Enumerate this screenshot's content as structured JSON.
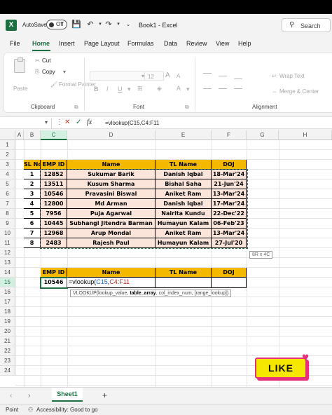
{
  "titlebar": {
    "autosave_label": "AutoSave",
    "autosave_state": "Off",
    "doc_title": "Book1 - Excel",
    "search_placeholder": "Search"
  },
  "menu": {
    "tabs": [
      "File",
      "Home",
      "Insert",
      "Page Layout",
      "Formulas",
      "Data",
      "Review",
      "View",
      "Help"
    ],
    "active": "Home"
  },
  "ribbon": {
    "paste": "Paste",
    "cut": "Cut",
    "copy": "Copy",
    "format_painter": "Format Painter",
    "clipboard": "Clipboard",
    "font_size": "12",
    "font_group": "Font",
    "wrap_text": "Wrap Text",
    "merge_center": "Merge & Center",
    "alignment_group": "Alignment"
  },
  "formula_bar": {
    "formula": "=vlookup(C15,C4:F11"
  },
  "columns": [
    "A",
    "B",
    "C",
    "D",
    "E",
    "F",
    "G",
    "H"
  ],
  "rows": [
    "1",
    "2",
    "3",
    "4",
    "5",
    "6",
    "7",
    "8",
    "9",
    "10",
    "11",
    "12",
    "13",
    "14",
    "15",
    "16",
    "17",
    "18",
    "19",
    "20",
    "21",
    "22",
    "23",
    "24"
  ],
  "table1": {
    "headers": [
      "SL No",
      "EMP ID",
      "Name",
      "TL Name",
      "DOJ"
    ],
    "rows": [
      [
        "1",
        "12852",
        "Sukumar Barik",
        "Danish Iqbal",
        "18-Mar'24"
      ],
      [
        "2",
        "13511",
        "Kusum Sharma",
        "Bishal Saha",
        "21-Jun'24"
      ],
      [
        "3",
        "10546",
        "Pravasini Biswal",
        "Aniket Ram",
        "13-Mar'24"
      ],
      [
        "4",
        "12800",
        "Md Arman",
        "Danish Iqbal",
        "17-Mar'24"
      ],
      [
        "5",
        "7956",
        "Puja Agarwal",
        "Nairita Kundu",
        "22-Dec'22"
      ],
      [
        "6",
        "10445",
        "Subhangi Jitendra Barman",
        "Humayun Kalam",
        "06-Feb'23"
      ],
      [
        "7",
        "12968",
        "Arup Mondal",
        "Aniket Ram",
        "13-Mar'24"
      ],
      [
        "8",
        "2483",
        "Rajesh Paul",
        "Humayun Kalam",
        "27-Jul'20"
      ]
    ]
  },
  "size_tip": "8R x 4C",
  "table2": {
    "headers": [
      "EMP ID",
      "Name",
      "TL Name",
      "DOJ"
    ],
    "emp_id": "10546",
    "formula_prefix": "=vlookup(",
    "formula_arg1": "C15",
    "formula_comma": ",",
    "formula_arg2": "C4:F11"
  },
  "function_tip": {
    "fn": "VLOOKUP(lookup_value, ",
    "bold_arg": "table_array",
    "rest": ", col_index_num, [range_lookup])"
  },
  "like_badge": "LIKE",
  "sheet_tab": "Sheet1",
  "status": {
    "mode": "Point",
    "accessibility": "Accessibility: Good to go"
  }
}
